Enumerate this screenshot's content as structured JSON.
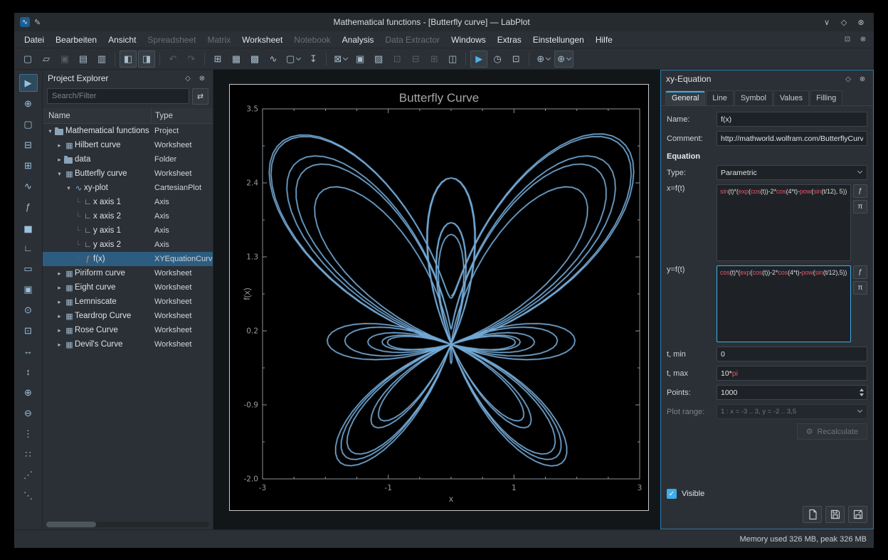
{
  "window": {
    "title": "Mathematical functions - [Butterfly curve] — LabPlot",
    "controls": {
      "minimize": "∨",
      "maximize": "◇",
      "close": "⊗"
    }
  },
  "icons": {
    "logo": "∿",
    "pen": "✎",
    "float": "◇",
    "close_circle": "⊗",
    "filter": "⇄",
    "restore": "⊡",
    "gear": "⚙",
    "function": "ƒ",
    "pi": "π"
  },
  "menubar": {
    "items": [
      {
        "label": "Datei",
        "enabled": true
      },
      {
        "label": "Bearbeiten",
        "enabled": true
      },
      {
        "label": "Ansicht",
        "enabled": true
      },
      {
        "label": "Spreadsheet",
        "enabled": false
      },
      {
        "label": "Matrix",
        "enabled": false
      },
      {
        "label": "Worksheet",
        "enabled": true
      },
      {
        "label": "Notebook",
        "enabled": false
      },
      {
        "label": "Analysis",
        "enabled": true
      },
      {
        "label": "Data Extractor",
        "enabled": false
      },
      {
        "label": "Windows",
        "enabled": true
      },
      {
        "label": "Extras",
        "enabled": true
      },
      {
        "label": "Einstellungen",
        "enabled": true
      },
      {
        "label": "Hilfe",
        "enabled": true
      }
    ]
  },
  "toolbar": {
    "buttons": [
      {
        "name": "new-project",
        "glyph": "▢"
      },
      {
        "name": "open-project",
        "glyph": "▱"
      },
      {
        "name": "save-project",
        "glyph": "▣",
        "disabled": true
      },
      {
        "name": "print",
        "glyph": "▤"
      },
      {
        "name": "print-preview",
        "glyph": "▥"
      },
      {
        "name": "toggle-project-explorer",
        "glyph": "◧",
        "active": true,
        "sep": true
      },
      {
        "name": "toggle-properties-dock",
        "glyph": "◨",
        "active": true
      },
      {
        "name": "undo",
        "glyph": "↶",
        "disabled": true,
        "sep": true
      },
      {
        "name": "redo",
        "glyph": "↷",
        "disabled": true
      },
      {
        "name": "new-worksheet",
        "glyph": "⊞",
        "sep": true
      },
      {
        "name": "new-spreadsheet",
        "glyph": "▦"
      },
      {
        "name": "new-matrix",
        "glyph": "▩"
      },
      {
        "name": "new-plot",
        "glyph": "∿"
      },
      {
        "name": "new-object",
        "glyph": "▢",
        "dropdown": true
      },
      {
        "name": "import-data",
        "glyph": "↧"
      },
      {
        "name": "add-plot",
        "glyph": "⊠",
        "dropdown": true,
        "sep": true
      },
      {
        "name": "add-text-label",
        "glyph": "▣"
      },
      {
        "name": "add-image",
        "glyph": "▨"
      },
      {
        "name": "select-mode",
        "glyph": "⊡",
        "disabled": true
      },
      {
        "name": "zoom-out-mode",
        "glyph": "⊟",
        "disabled": true
      },
      {
        "name": "zoom-in-mode",
        "glyph": "⊞",
        "disabled": true
      },
      {
        "name": "layout",
        "glyph": "◫"
      },
      {
        "name": "presenter-mode",
        "glyph": "▶",
        "accent": true,
        "active": true,
        "sep": true
      },
      {
        "name": "history",
        "glyph": "◷"
      },
      {
        "name": "fit-selection",
        "glyph": "⊡"
      },
      {
        "name": "zoom-mode",
        "glyph": "⊕",
        "dropdown": true,
        "sep": true
      },
      {
        "name": "magnification",
        "glyph": "⊕",
        "dropdown": true,
        "active": true
      }
    ]
  },
  "tool_strip": {
    "buttons": [
      {
        "name": "select-tool",
        "glyph": "▶",
        "active": true
      },
      {
        "name": "crosshair-tool",
        "glyph": "⊕"
      },
      {
        "name": "zoom-selection-tool",
        "glyph": "▢"
      },
      {
        "name": "zoom-x-selection-tool",
        "glyph": "⊟"
      },
      {
        "name": "zoom-y-selection-tool",
        "glyph": "⊞"
      },
      {
        "name": "add-curve-tool",
        "glyph": "∿"
      },
      {
        "name": "add-equation-curve-tool",
        "glyph": "ƒ"
      },
      {
        "name": "add-histogram-tool",
        "glyph": "▅"
      },
      {
        "name": "add-axis-tool",
        "glyph": "∟"
      },
      {
        "name": "add-legend-tool",
        "glyph": "▭"
      },
      {
        "name": "add-text-label-tool",
        "glyph": "▣"
      },
      {
        "name": "add-info-element-tool",
        "glyph": "⊙"
      },
      {
        "name": "auto-scale-tool",
        "glyph": "⊡"
      },
      {
        "name": "auto-scale-x-tool",
        "glyph": "↔"
      },
      {
        "name": "auto-scale-y-tool",
        "glyph": "↕"
      },
      {
        "name": "zoom-in-tool",
        "glyph": "⊕"
      },
      {
        "name": "zoom-out-tool",
        "glyph": "⊖"
      },
      {
        "name": "shift-left-tool",
        "glyph": "⋮"
      },
      {
        "name": "shift-right-tool",
        "glyph": "∷"
      },
      {
        "name": "shift-up-tool",
        "glyph": "⋰"
      },
      {
        "name": "shift-down-tool",
        "glyph": "⋱"
      }
    ]
  },
  "project_explorer": {
    "title": "Project Explorer",
    "search_placeholder": "Search/Filter",
    "columns": [
      "Name",
      "Type"
    ],
    "rows": [
      {
        "name": "Mathematical functions",
        "type": "Project",
        "level": 0,
        "expand": "open",
        "icon": "folder"
      },
      {
        "name": "Hilbert curve",
        "type": "Worksheet",
        "level": 1,
        "expand": "closed",
        "icon": "worksheet"
      },
      {
        "name": "data",
        "type": "Folder",
        "level": 1,
        "expand": "closed",
        "icon": "folder"
      },
      {
        "name": "Butterfly curve",
        "type": "Worksheet",
        "level": 1,
        "expand": "open",
        "icon": "worksheet"
      },
      {
        "name": "xy-plot",
        "type": "CartesianPlot",
        "level": 2,
        "expand": "open",
        "icon": "plot"
      },
      {
        "name": "x axis 1",
        "type": "Axis",
        "level": 3,
        "guide": true,
        "icon": "axis"
      },
      {
        "name": "x axis 2",
        "type": "Axis",
        "level": 3,
        "guide": true,
        "icon": "axis"
      },
      {
        "name": "y axis 1",
        "type": "Axis",
        "level": 3,
        "guide": true,
        "icon": "axis"
      },
      {
        "name": "y axis 2",
        "type": "Axis",
        "level": 3,
        "guide": true,
        "icon": "axis"
      },
      {
        "name": "f(x)",
        "type": "XYEquationCurve",
        "level": 3,
        "guide": true,
        "icon": "curve",
        "selected": true
      },
      {
        "name": "Piriform curve",
        "type": "Worksheet",
        "level": 1,
        "expand": "closed",
        "icon": "worksheet"
      },
      {
        "name": "Eight curve",
        "type": "Worksheet",
        "level": 1,
        "expand": "closed",
        "icon": "worksheet"
      },
      {
        "name": "Lemniscate",
        "type": "Worksheet",
        "level": 1,
        "expand": "closed",
        "icon": "worksheet"
      },
      {
        "name": "Teardrop Curve",
        "type": "Worksheet",
        "level": 1,
        "expand": "closed",
        "icon": "worksheet"
      },
      {
        "name": "Rose Curve",
        "type": "Worksheet",
        "level": 1,
        "expand": "closed",
        "icon": "worksheet"
      },
      {
        "name": "Devil's Curve",
        "type": "Worksheet",
        "level": 1,
        "expand": "closed",
        "icon": "worksheet"
      }
    ]
  },
  "dock": {
    "title": "xy-Equation",
    "tabs": [
      "General",
      "Line",
      "Symbol",
      "Values",
      "Filling"
    ],
    "active_tab": "General",
    "highlight_tokens": [
      "sin",
      "cos",
      "exp",
      "pow",
      "pi"
    ],
    "fields": {
      "name_label": "Name:",
      "name_value": "f(x)",
      "comment_label": "Comment:",
      "comment_value": "http://mathworld.wolfram.com/ButterflyCurve.html",
      "section_equation": "Equation",
      "type_label": "Type:",
      "type_value": "Parametric",
      "x_label": "x=f(t)",
      "x_expr": "sin(t)*(exp(cos(t))-2*cos(4*t)-pow(sin(t/12), 5))",
      "y_label": "y=f(t)",
      "y_expr": "cos(t)*(exp(cos(t))-2*cos(4*t)-pow(sin(t/12),5))",
      "tmin_label": "t, min",
      "tmin_value": "0",
      "tmax_label": "t, max",
      "tmax_value": "10*pi",
      "points_label": "Points:",
      "points_value": "1000",
      "plot_range_label": "Plot range:",
      "plot_range_value": "1 : x = -3 .. 3, y = -2 .. 3,5",
      "recalculate_label": "Recalculate",
      "visible_label": "Visible",
      "visible_checked": true
    }
  },
  "statusbar": {
    "memory": "Memory used 326 MB, peak 326 MB"
  },
  "chart_data": {
    "type": "line",
    "subtype": "parametric",
    "title": "Butterfly Curve",
    "xlabel": "x",
    "ylabel": "f(x)",
    "xlim": [
      -3,
      3
    ],
    "ylim": [
      -2.0,
      3.5
    ],
    "xticks": [
      -3,
      -1,
      1,
      3
    ],
    "yticks": [
      3.5,
      2.4,
      1.3,
      0.2,
      -0.9,
      -2.0
    ],
    "x_expr": "sin(t)*(exp(cos(t))-2*cos(4*t)-pow(sin(t/12), 5))",
    "y_expr": "cos(t)*(exp(cos(t))-2*cos(4*t)-pow(sin(t/12),5))",
    "t_min": 0,
    "t_max": "10*pi",
    "points": 1000,
    "curve_color": "#72a7d3",
    "axis_color": "#8d9398",
    "background": "#000000",
    "grid": false,
    "legend": false
  }
}
